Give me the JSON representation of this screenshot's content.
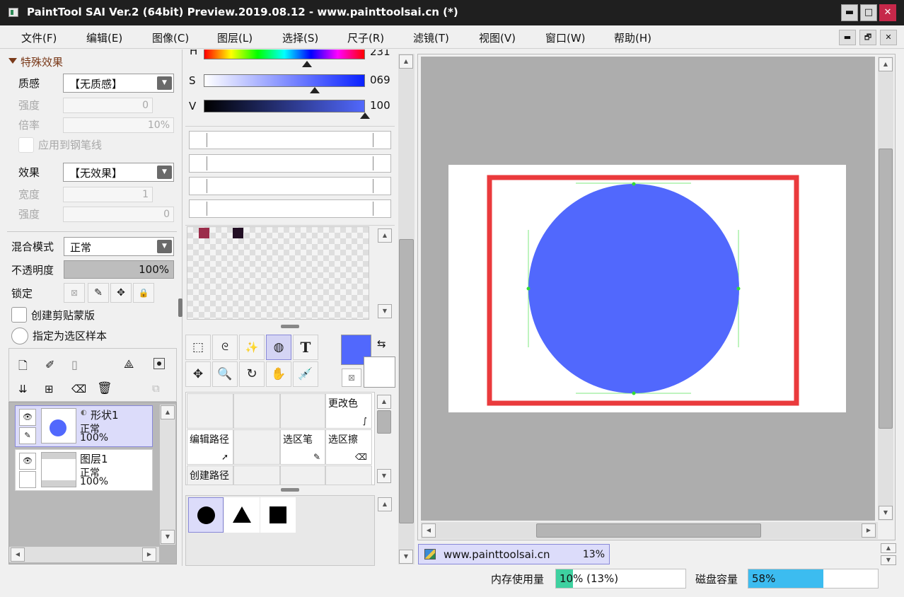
{
  "window": {
    "title": "PaintTool SAI Ver.2 (64bit) Preview.2019.08.12 - www.painttoolsai.cn (*)",
    "minimize": "▬",
    "maximize": "□",
    "close": "✕"
  },
  "menu": [
    "文件(F)",
    "编辑(E)",
    "图像(C)",
    "图层(L)",
    "选择(S)",
    "尺子(R)",
    "滤镜(T)",
    "视图(V)",
    "窗口(W)",
    "帮助(H)"
  ],
  "mdi": {
    "minimize": "▬",
    "restore": "🗗",
    "close": "✕"
  },
  "effects": {
    "section_title": "特殊效果",
    "texture_label": "质感",
    "texture_value": "【无质感】",
    "strength_label": "强度",
    "strength_value": "0",
    "scale_label": "倍率",
    "scale_value": "10%",
    "apply_pen_label": "应用到钢笔线",
    "effect_label": "效果",
    "effect_value": "【无效果】",
    "width_label": "宽度",
    "width_value": "1",
    "strength2_label": "强度",
    "strength2_value": "0"
  },
  "layer_props": {
    "blend_label": "混合模式",
    "blend_value": "正常",
    "opacity_label": "不透明度",
    "opacity_value": "100%",
    "opacity_fraction": 1.0,
    "lock_label": "锁定",
    "clip_label": "创建剪贴蒙版",
    "sample_label": "指定为选区样本"
  },
  "layers": [
    {
      "name": "形状1",
      "mode": "正常",
      "opacity": "100%",
      "selected": true
    },
    {
      "name": "图层1",
      "mode": "正常",
      "opacity": "100%",
      "selected": false
    }
  ],
  "color": {
    "h_label": "H",
    "h_value": "231",
    "s_label": "S",
    "s_value": "069",
    "v_label": "V",
    "v_value": "100",
    "h_fraction": 0.64,
    "s_fraction": 0.69,
    "v_fraction": 1.0,
    "swatch1": "#9b2c4a",
    "swatch2": "#231025",
    "fg": "#5168fd",
    "bg": "#ffffff"
  },
  "tool_cells": {
    "recolor": "更改色",
    "edit_path": "编辑路径",
    "sel_pen": "选区笔",
    "sel_eraser": "选区擦",
    "create_path": "创建路径"
  },
  "canvas": {
    "doc_name": "www.painttoolsai.cn",
    "zoom": "13%",
    "shape_color": "#5168fd",
    "frame_color": "#ea3a3c"
  },
  "status": {
    "mem_label": "内存使用量",
    "mem_value": "10% (13%)",
    "mem_fraction": 0.1,
    "disk_label": "磁盘容量",
    "disk_value": "58%",
    "disk_fraction": 0.58
  }
}
